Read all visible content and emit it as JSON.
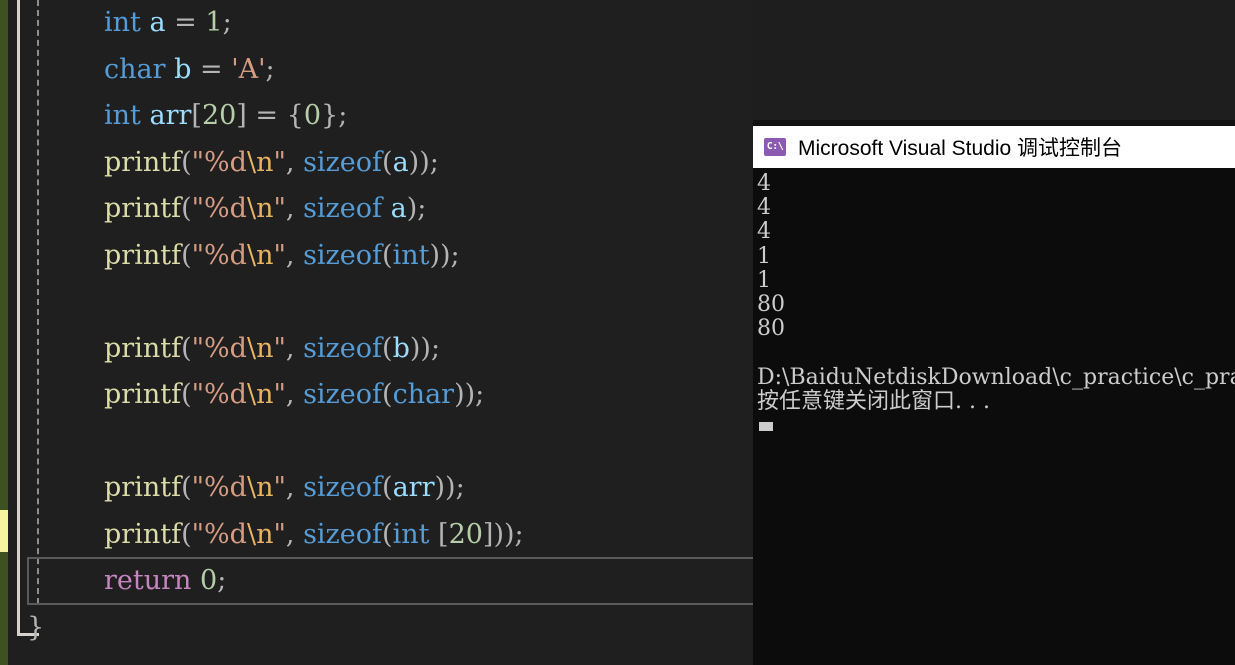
{
  "editor": {
    "language": "c",
    "theme_background": "#1f1f1f",
    "change_bar": {
      "saved_color": "#3d5220",
      "unsaved_color": "#f5f3a0"
    },
    "lines": [
      {
        "id": "line-int-a",
        "tokens": [
          {
            "t": "int",
            "c": "t-kw"
          },
          {
            "t": " ",
            "c": "t-punct"
          },
          {
            "t": "a",
            "c": "t-var"
          },
          {
            "t": " = ",
            "c": "t-punct"
          },
          {
            "t": "1",
            "c": "t-num"
          },
          {
            "t": ";",
            "c": "t-punct"
          }
        ]
      },
      {
        "id": "line-char-b",
        "tokens": [
          {
            "t": "char",
            "c": "t-kw"
          },
          {
            "t": " ",
            "c": "t-punct"
          },
          {
            "t": "b",
            "c": "t-var"
          },
          {
            "t": " = ",
            "c": "t-punct"
          },
          {
            "t": "'A'",
            "c": "t-str"
          },
          {
            "t": ";",
            "c": "t-punct"
          }
        ]
      },
      {
        "id": "line-int-arr",
        "tokens": [
          {
            "t": "int",
            "c": "t-kw"
          },
          {
            "t": " ",
            "c": "t-punct"
          },
          {
            "t": "arr",
            "c": "t-var"
          },
          {
            "t": "[",
            "c": "t-punct"
          },
          {
            "t": "20",
            "c": "t-num"
          },
          {
            "t": "]",
            "c": "t-punct"
          },
          {
            "t": " = ",
            "c": "t-punct"
          },
          {
            "t": "{",
            "c": "t-punct"
          },
          {
            "t": "0",
            "c": "t-num"
          },
          {
            "t": "}",
            "c": "t-punct"
          },
          {
            "t": ";",
            "c": "t-punct"
          }
        ]
      },
      {
        "id": "line-printf-sizeof-a-paren",
        "tokens": [
          {
            "t": "printf",
            "c": "t-fn"
          },
          {
            "t": "(",
            "c": "t-punct"
          },
          {
            "t": "\"%d",
            "c": "t-str"
          },
          {
            "t": "\\n",
            "c": "t-esc"
          },
          {
            "t": "\"",
            "c": "t-str"
          },
          {
            "t": ", ",
            "c": "t-punct"
          },
          {
            "t": "sizeof",
            "c": "t-sizeof"
          },
          {
            "t": "(",
            "c": "t-punct"
          },
          {
            "t": "a",
            "c": "t-var"
          },
          {
            "t": "))",
            "c": "t-punct"
          },
          {
            "t": ";",
            "c": "t-punct"
          }
        ]
      },
      {
        "id": "line-printf-sizeof-a",
        "tokens": [
          {
            "t": "printf",
            "c": "t-fn"
          },
          {
            "t": "(",
            "c": "t-punct"
          },
          {
            "t": "\"%d",
            "c": "t-str"
          },
          {
            "t": "\\n",
            "c": "t-esc"
          },
          {
            "t": "\"",
            "c": "t-str"
          },
          {
            "t": ", ",
            "c": "t-punct"
          },
          {
            "t": "sizeof",
            "c": "t-sizeof"
          },
          {
            "t": " ",
            "c": "t-punct"
          },
          {
            "t": "a",
            "c": "t-var"
          },
          {
            "t": ")",
            "c": "t-punct"
          },
          {
            "t": ";",
            "c": "t-punct"
          }
        ]
      },
      {
        "id": "line-printf-sizeof-int",
        "tokens": [
          {
            "t": "printf",
            "c": "t-fn"
          },
          {
            "t": "(",
            "c": "t-punct"
          },
          {
            "t": "\"%d",
            "c": "t-str"
          },
          {
            "t": "\\n",
            "c": "t-esc"
          },
          {
            "t": "\"",
            "c": "t-str"
          },
          {
            "t": ", ",
            "c": "t-punct"
          },
          {
            "t": "sizeof",
            "c": "t-sizeof"
          },
          {
            "t": "(",
            "c": "t-punct"
          },
          {
            "t": "int",
            "c": "t-kw"
          },
          {
            "t": "))",
            "c": "t-punct"
          },
          {
            "t": ";",
            "c": "t-punct"
          }
        ]
      },
      {
        "id": "line-blank-1",
        "tokens": []
      },
      {
        "id": "line-printf-sizeof-b",
        "tokens": [
          {
            "t": "printf",
            "c": "t-fn"
          },
          {
            "t": "(",
            "c": "t-punct"
          },
          {
            "t": "\"%d",
            "c": "t-str"
          },
          {
            "t": "\\n",
            "c": "t-esc"
          },
          {
            "t": "\"",
            "c": "t-str"
          },
          {
            "t": ", ",
            "c": "t-punct"
          },
          {
            "t": "sizeof",
            "c": "t-sizeof"
          },
          {
            "t": "(",
            "c": "t-punct"
          },
          {
            "t": "b",
            "c": "t-var"
          },
          {
            "t": "))",
            "c": "t-punct"
          },
          {
            "t": ";",
            "c": "t-punct"
          }
        ]
      },
      {
        "id": "line-printf-sizeof-char",
        "tokens": [
          {
            "t": "printf",
            "c": "t-fn"
          },
          {
            "t": "(",
            "c": "t-punct"
          },
          {
            "t": "\"%d",
            "c": "t-str"
          },
          {
            "t": "\\n",
            "c": "t-esc"
          },
          {
            "t": "\"",
            "c": "t-str"
          },
          {
            "t": ", ",
            "c": "t-punct"
          },
          {
            "t": "sizeof",
            "c": "t-sizeof"
          },
          {
            "t": "(",
            "c": "t-punct"
          },
          {
            "t": "char",
            "c": "t-kw"
          },
          {
            "t": "))",
            "c": "t-punct"
          },
          {
            "t": ";",
            "c": "t-punct"
          }
        ]
      },
      {
        "id": "line-blank-2",
        "tokens": []
      },
      {
        "id": "line-printf-sizeof-arr",
        "tokens": [
          {
            "t": "printf",
            "c": "t-fn"
          },
          {
            "t": "(",
            "c": "t-punct"
          },
          {
            "t": "\"%d",
            "c": "t-str"
          },
          {
            "t": "\\n",
            "c": "t-esc"
          },
          {
            "t": "\"",
            "c": "t-str"
          },
          {
            "t": ", ",
            "c": "t-punct"
          },
          {
            "t": "sizeof",
            "c": "t-sizeof"
          },
          {
            "t": "(",
            "c": "t-punct"
          },
          {
            "t": "arr",
            "c": "t-var"
          },
          {
            "t": "))",
            "c": "t-punct"
          },
          {
            "t": ";",
            "c": "t-punct"
          }
        ]
      },
      {
        "id": "line-printf-sizeof-int-20",
        "tokens": [
          {
            "t": "printf",
            "c": "t-fn"
          },
          {
            "t": "(",
            "c": "t-punct"
          },
          {
            "t": "\"%d",
            "c": "t-str"
          },
          {
            "t": "\\n",
            "c": "t-esc"
          },
          {
            "t": "\"",
            "c": "t-str"
          },
          {
            "t": ", ",
            "c": "t-punct"
          },
          {
            "t": "sizeof",
            "c": "t-sizeof"
          },
          {
            "t": "(",
            "c": "t-punct"
          },
          {
            "t": "int",
            "c": "t-kw"
          },
          {
            "t": " [",
            "c": "t-punct"
          },
          {
            "t": "20",
            "c": "t-num"
          },
          {
            "t": "]))",
            "c": "t-punct"
          },
          {
            "t": ";",
            "c": "t-punct"
          }
        ]
      },
      {
        "id": "line-return",
        "current": true,
        "tokens": [
          {
            "t": "return",
            "c": "t-ctrl"
          },
          {
            "t": " ",
            "c": "t-punct"
          },
          {
            "t": "0",
            "c": "t-num"
          },
          {
            "t": ";",
            "c": "t-punct"
          }
        ]
      },
      {
        "id": "line-close-brace",
        "brace": true,
        "tokens": [
          {
            "t": "}",
            "c": "t-punct"
          }
        ]
      }
    ]
  },
  "console": {
    "title": "Microsoft Visual Studio 调试控制台",
    "icon_label": "C:\\",
    "icon_color": "#8a5bb0",
    "background": "#0c0c0c",
    "text_color": "#cccccc",
    "output_lines": [
      "4",
      "4",
      "4",
      "1",
      "1",
      "80",
      "80",
      "",
      "D:\\BaiduNetdiskDownload\\c_practice\\c_pra",
      "按任意键关闭此窗口. . ."
    ],
    "cursor_visible": true
  }
}
